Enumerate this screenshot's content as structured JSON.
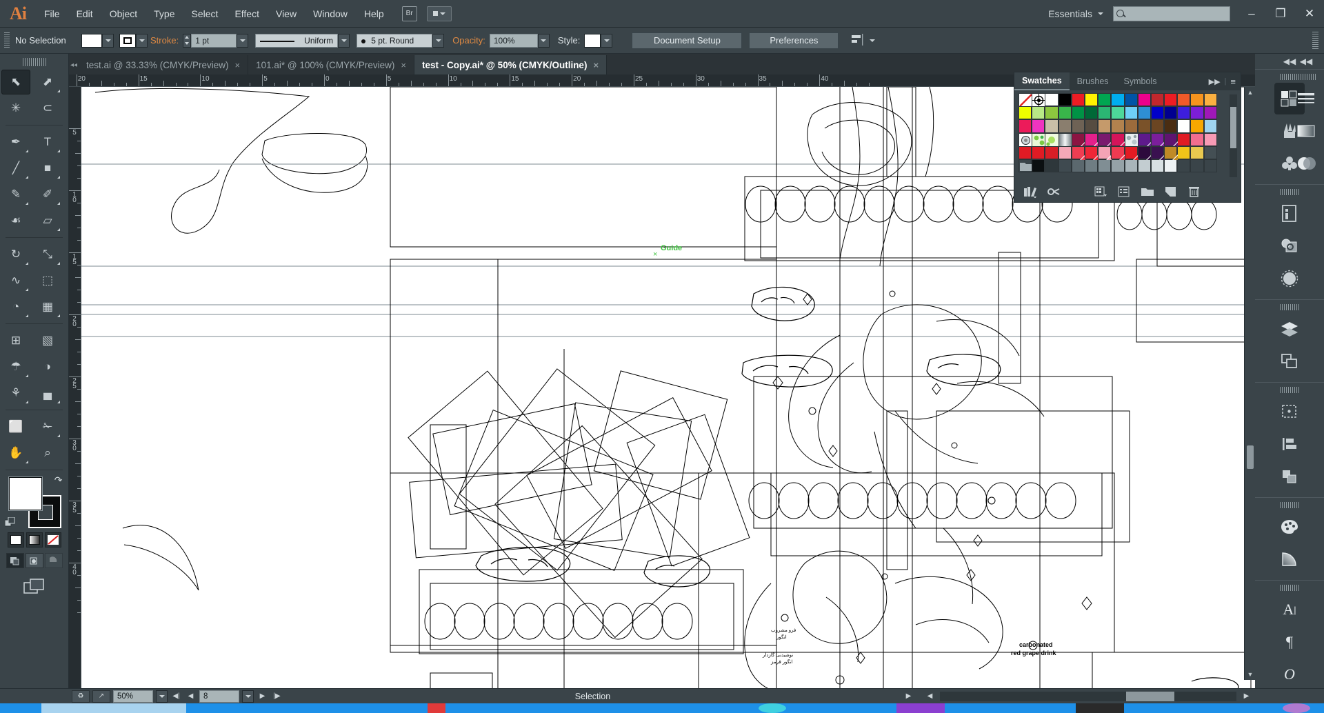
{
  "app": {
    "name": "Adobe Illustrator",
    "logo_text": "Ai",
    "workspace": "Essentials",
    "accent_orange": "#e08a43",
    "chrome_bg": "#3a4449"
  },
  "menubar": {
    "items": [
      "File",
      "Edit",
      "Object",
      "Type",
      "Select",
      "Effect",
      "View",
      "Window",
      "Help"
    ],
    "bridge_label": "Br",
    "workspace_label": "Essentials",
    "search_placeholder": "",
    "window_buttons": [
      "minimize",
      "restore",
      "close"
    ]
  },
  "controlbar": {
    "selection_status": "No Selection",
    "stroke_label": "Stroke:",
    "stroke_weight": "1 pt",
    "profile_label": "Uniform",
    "brush_label": "5 pt. Round",
    "opacity_label": "Opacity:",
    "opacity_value": "100%",
    "style_label": "Style:",
    "document_setup_label": "Document Setup",
    "preferences_label": "Preferences",
    "fill_color": "#ffffff",
    "stroke_color": "#000000"
  },
  "tabs": [
    {
      "title": "test.ai @ 33.33% (CMYK/Preview)",
      "active": false,
      "close": "×"
    },
    {
      "title": "101.ai* @ 100% (CMYK/Preview)",
      "active": false,
      "close": "×"
    },
    {
      "title": "test - Copy.ai* @ 50% (CMYK/Outline)",
      "active": true,
      "close": "×"
    }
  ],
  "toolbar": {
    "tools": [
      {
        "name": "selection-tool",
        "glyph": "⬉",
        "selected": true,
        "flyout": false
      },
      {
        "name": "direct-selection-tool",
        "glyph": "⬈",
        "selected": false,
        "flyout": true
      },
      {
        "name": "magic-wand-tool",
        "glyph": "✳",
        "selected": false,
        "flyout": false
      },
      {
        "name": "lasso-tool",
        "glyph": "⊂",
        "selected": false,
        "flyout": false
      },
      {
        "name": "pen-tool",
        "glyph": "✒",
        "selected": false,
        "flyout": true
      },
      {
        "name": "type-tool",
        "glyph": "T",
        "selected": false,
        "flyout": true
      },
      {
        "name": "line-segment-tool",
        "glyph": "╱",
        "selected": false,
        "flyout": true
      },
      {
        "name": "rectangle-tool",
        "glyph": "■",
        "selected": false,
        "flyout": true
      },
      {
        "name": "paintbrush-tool",
        "glyph": "✎",
        "selected": false,
        "flyout": true
      },
      {
        "name": "pencil-tool",
        "glyph": "✐",
        "selected": false,
        "flyout": true
      },
      {
        "name": "blob-brush-tool",
        "glyph": "☙",
        "selected": false,
        "flyout": false
      },
      {
        "name": "eraser-tool",
        "glyph": "▱",
        "selected": false,
        "flyout": true
      },
      {
        "name": "rotate-tool",
        "glyph": "↻",
        "selected": false,
        "flyout": true
      },
      {
        "name": "scale-tool",
        "glyph": "⤡",
        "selected": false,
        "flyout": true
      },
      {
        "name": "width-tool",
        "glyph": "∿",
        "selected": false,
        "flyout": true
      },
      {
        "name": "free-transform-tool",
        "glyph": "⬚",
        "selected": false,
        "flyout": false
      },
      {
        "name": "shape-builder-tool",
        "glyph": "◔",
        "selected": false,
        "flyout": true
      },
      {
        "name": "perspective-grid-tool",
        "glyph": "▦",
        "selected": false,
        "flyout": true
      },
      {
        "name": "mesh-tool",
        "glyph": "⊞",
        "selected": false,
        "flyout": false
      },
      {
        "name": "gradient-tool",
        "glyph": "▧",
        "selected": false,
        "flyout": false
      },
      {
        "name": "eyedropper-tool",
        "glyph": "☂",
        "selected": false,
        "flyout": true
      },
      {
        "name": "blend-tool",
        "glyph": "◑",
        "selected": false,
        "flyout": false
      },
      {
        "name": "symbol-sprayer-tool",
        "glyph": "⚘",
        "selected": false,
        "flyout": true
      },
      {
        "name": "column-graph-tool",
        "glyph": "▄",
        "selected": false,
        "flyout": true
      },
      {
        "name": "artboard-tool",
        "glyph": "⬜",
        "selected": false,
        "flyout": false
      },
      {
        "name": "slice-tool",
        "glyph": "✁",
        "selected": false,
        "flyout": true
      },
      {
        "name": "hand-tool",
        "glyph": "✋",
        "selected": false,
        "flyout": true
      },
      {
        "name": "zoom-tool",
        "glyph": "⌕",
        "selected": false,
        "flyout": false
      }
    ],
    "fill_color": "#ffffff",
    "stroke_color": "#000000",
    "color_modes": [
      "color",
      "gradient",
      "none"
    ],
    "draw_modes": [
      "draw-normal",
      "draw-behind",
      "draw-inside"
    ],
    "screen_mode": "change-screen-mode"
  },
  "rulers": {
    "unit": "cm",
    "top_labels": [
      "20",
      "15",
      "10",
      "5",
      "0",
      "5",
      "10",
      "15",
      "20",
      "25",
      "30",
      "35",
      "40"
    ],
    "left_labels": [
      "5",
      "10",
      "15",
      "20",
      "25",
      "30",
      "35",
      "40"
    ]
  },
  "canvas": {
    "guide_label": "Guide",
    "guide_marker": "×",
    "artwork_texts": [
      "carbonated",
      "red grape drink"
    ],
    "view_mode": "Outline"
  },
  "swatches_panel": {
    "tabs": [
      {
        "label": "Swatches",
        "active": true
      },
      {
        "label": "Brushes",
        "active": false
      },
      {
        "label": "Symbols",
        "active": false
      }
    ],
    "expand_glyph": "▶▶",
    "menu_glyph": "≡",
    "rows": [
      [
        "none",
        "registration",
        "#ffffff",
        "#000000",
        "#ed1c24",
        "#fff200",
        "#00a651",
        "#00aeef",
        "#0054a6",
        "#ec008c",
        "#c1272d",
        "#ed1c24",
        "#f15a29",
        "#f7941e",
        "#fbb040"
      ],
      [
        "#eeff00",
        "#b8e986",
        "#8dc63f",
        "#39b54a",
        "#009245",
        "#006837",
        "#2bb673",
        "#4dd79a",
        "#6ecff6",
        "#2e8fd4",
        "#0000c8",
        "#00008f",
        "#3d1ede",
        "#7c1ed6",
        "#a018b8"
      ],
      [
        "#ec1b5a",
        "#ef34c0",
        "#c9bfa8",
        "#8a7e6e",
        "#6e6255",
        "#564c41",
        "#c59a6b",
        "#b2824e",
        "#9c6b3c",
        "#7a5229",
        "#6b4522",
        "#4a2d12",
        "#ffffff",
        "#f7a800",
        "#9fd4ef"
      ],
      [
        "pattern-dot",
        "pattern-leaf",
        "pattern-leaf2",
        "gradient-steel",
        "#8c1442",
        "#e5208b",
        "#7a1a6e",
        "#d4145a",
        "pattern-camo",
        "#5e1a8c",
        "#7b1e9c",
        "#5f1470",
        "#e01b24",
        "#f26d8f",
        "#f79ab4"
      ],
      [
        "#e01b24",
        "#e01b24",
        "#d81e26",
        "#f5a8b8",
        "#ef3d52",
        "#ee2737",
        "#f5a3b6",
        "#ef3a51",
        "#e31b23",
        "#2d0a3d",
        "#3a1150",
        "#c08a26",
        "#f0c419",
        "#e8c84f",
        "#444f54"
      ],
      [
        "folder",
        "#0b0f11",
        "#2e373b",
        "#3f4a50",
        "#5b686e",
        "#6f7d83",
        "#808e94",
        "#95a2a7",
        "#a9b5ba",
        "#c3cdd1",
        "#d8e0e3",
        "#eef2f4",
        "#3a4449",
        "#3a4449",
        "#3a4449"
      ]
    ],
    "bottom_buttons": [
      "swatch-libraries-menu",
      "show-swatch-kinds-menu",
      "swatch-options",
      "new-color-group",
      "new-swatch",
      "delete-swatch"
    ]
  },
  "dock": {
    "collapse_glyph": "◀◀",
    "groups": [
      {
        "icons": [
          {
            "name": "swatches-panel-icon",
            "selected": true
          },
          {
            "name": "brushes-panel-icon",
            "selected": false
          },
          {
            "name": "symbols-panel-icon",
            "selected": false
          }
        ]
      },
      {
        "icons": [
          {
            "name": "document-info-panel-icon",
            "selected": false
          },
          {
            "name": "links-panel-icon",
            "selected": false
          },
          {
            "name": "appearance-panel-icon",
            "selected": false
          }
        ]
      },
      {
        "icons": [
          {
            "name": "layers-panel-icon",
            "selected": false
          },
          {
            "name": "artboards-panel-icon",
            "selected": false
          }
        ]
      },
      {
        "icons": [
          {
            "name": "transform-panel-icon",
            "selected": false
          },
          {
            "name": "align-panel-icon",
            "selected": false
          },
          {
            "name": "pathfinder-panel-icon",
            "selected": false
          }
        ]
      },
      {
        "icons": [
          {
            "name": "color-panel-icon",
            "selected": false
          },
          {
            "name": "gradient-panel-icon",
            "selected": false
          }
        ]
      },
      {
        "icons": [
          {
            "name": "character-panel-icon",
            "selected": false
          },
          {
            "name": "paragraph-panel-icon",
            "selected": false
          },
          {
            "name": "opentype-panel-icon",
            "selected": false
          }
        ]
      }
    ],
    "column2": [
      {
        "name": "stroke-panel-icon"
      },
      {
        "name": "gradient2-panel-icon"
      },
      {
        "name": "transparency-panel-icon"
      }
    ]
  },
  "statusbar": {
    "zoom_value": "50%",
    "artboard_number": "8",
    "status_text": "Selection",
    "nav_first": "◀|",
    "nav_prev": "◀",
    "nav_next": "▶",
    "nav_last": "|▶"
  }
}
